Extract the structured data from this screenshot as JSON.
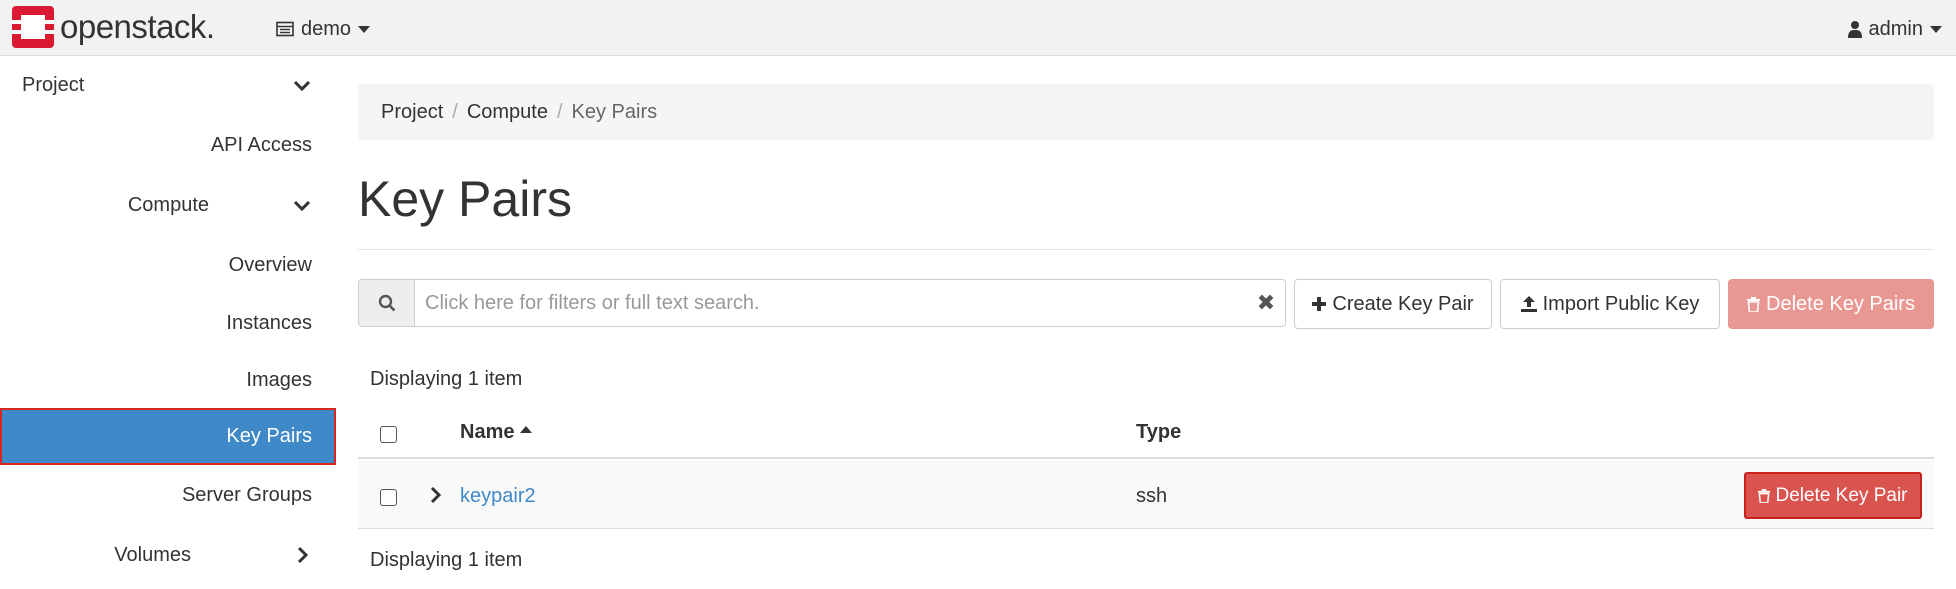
{
  "app": {
    "logo_text": "openstack.",
    "brand_color": "#da1a32"
  },
  "topbar": {
    "project_label": "demo",
    "user_label": "admin"
  },
  "sidebar": {
    "items": [
      {
        "label": "Project"
      },
      {
        "label": "API Access"
      },
      {
        "label": "Compute"
      },
      {
        "label": "Overview"
      },
      {
        "label": "Instances"
      },
      {
        "label": "Images"
      },
      {
        "label": "Key Pairs"
      },
      {
        "label": "Server Groups"
      },
      {
        "label": "Volumes"
      }
    ],
    "active_color": "#3f89c9"
  },
  "breadcrumb": {
    "items": [
      "Project",
      "Compute",
      "Key Pairs"
    ],
    "separator": "/"
  },
  "page": {
    "title": "Key Pairs"
  },
  "toolbar": {
    "search_placeholder": "Click here for filters or full text search.",
    "create_label": "Create Key Pair",
    "import_label": "Import Public Key",
    "delete_all_label": "Delete Key Pairs"
  },
  "table": {
    "count_top": "Displaying 1 item",
    "count_bottom": "Displaying 1 item",
    "columns": [
      "Name",
      "Type"
    ],
    "rows": [
      {
        "name": "keypair2",
        "type": "ssh",
        "action": "Delete Key Pair"
      }
    ]
  }
}
